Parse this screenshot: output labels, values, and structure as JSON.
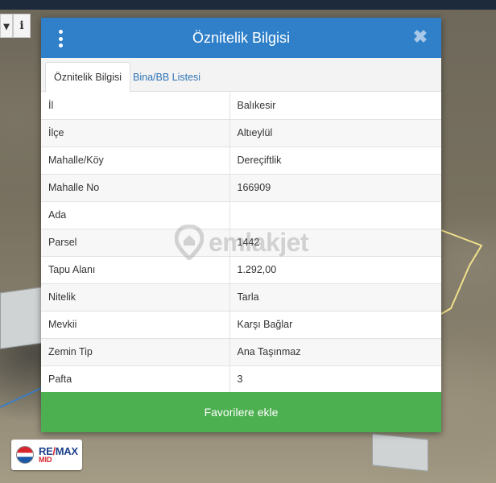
{
  "map": {
    "tool_left_glyph": "▾",
    "tool_info_glyph": "i"
  },
  "dialog": {
    "title": "Öznitelik Bilgisi",
    "close_glyph": "✖",
    "tabs": [
      {
        "label": "Öznitelik Bilgisi",
        "active": true
      },
      {
        "label": "Bina/BB Listesi",
        "active": false
      }
    ],
    "rows": [
      {
        "key": "İl",
        "value": "Balıkesir"
      },
      {
        "key": "İlçe",
        "value": "Altıeylül"
      },
      {
        "key": "Mahalle/Köy",
        "value": "Dereçiftlik"
      },
      {
        "key": "Mahalle No",
        "value": "166909"
      },
      {
        "key": "Ada",
        "value": ""
      },
      {
        "key": "Parsel",
        "value": "1442"
      },
      {
        "key": "Tapu Alanı",
        "value": "1.292,00"
      },
      {
        "key": "Nitelik",
        "value": "Tarla"
      },
      {
        "key": "Mevkii",
        "value": "Karşı Bağlar"
      },
      {
        "key": "Zemin Tip",
        "value": "Ana Taşınmaz"
      },
      {
        "key": "Pafta",
        "value": "3"
      }
    ],
    "favorite_button_label": "Favorilere ekle"
  },
  "watermark": {
    "text": "emlakjet"
  },
  "remax": {
    "brand_a": "RE",
    "brand_sep": "/",
    "brand_b": "MAX",
    "office": "MID"
  },
  "colors": {
    "header_blue": "#2f80c9",
    "button_green": "#4caf50",
    "tab_link_blue": "#2f74b5",
    "parcel_outline": "#f0e08a"
  }
}
